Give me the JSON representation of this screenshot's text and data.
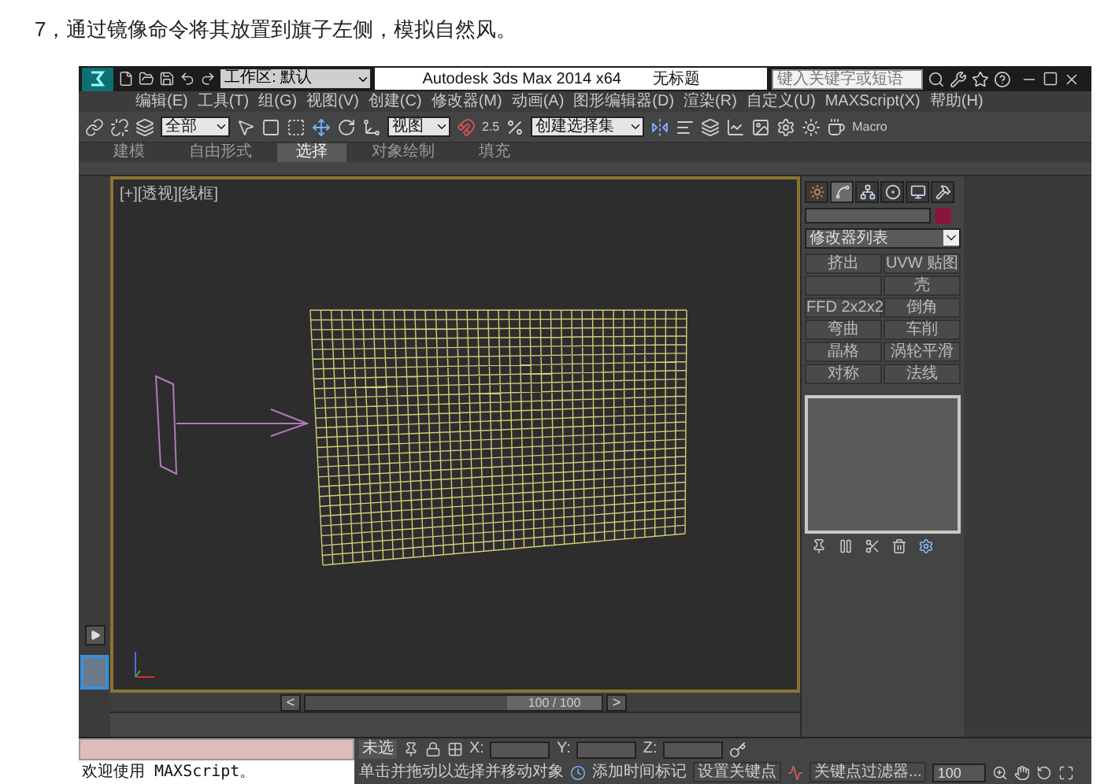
{
  "caption": "7，通过镜像命令将其放置到旗子左侧，模拟自然风。",
  "title_bar": {
    "workspace": "工作区: 默认",
    "title": "Autodesk 3ds Max 2014 x64",
    "document": "无标题",
    "search": {
      "placeholder": "键入关键字或短语"
    }
  },
  "menu": [
    "编辑(E)",
    "工具(T)",
    "组(G)",
    "视图(V)",
    "创建(C)",
    "修改器(M)",
    "动画(A)",
    "图形编辑器(D)",
    "渲染(R)",
    "自定义(U)",
    "MAXScript(X)",
    "帮助(H)"
  ],
  "toolbar": {
    "selection_filter": "全部",
    "reference_coord": "视图",
    "snap_value": "2.5",
    "selection_set": "创建选择集",
    "macro": "Macro"
  },
  "ribbon_tabs": [
    {
      "label": "建模",
      "selected": false
    },
    {
      "label": "自由形式",
      "selected": false
    },
    {
      "label": "选择",
      "selected": true
    },
    {
      "label": "对象绘制",
      "selected": false
    },
    {
      "label": "填充",
      "selected": false
    }
  ],
  "viewport": {
    "label": "[+][透视][线框]"
  },
  "command_panel": {
    "tabs": [
      {
        "selected": false
      },
      {
        "selected": true
      },
      {
        "selected": false
      },
      {
        "selected": false
      },
      {
        "selected": false
      },
      {
        "selected": false
      }
    ],
    "modifier_list": "修改器列表",
    "modifier_buttons": [
      {
        "kind": "command",
        "label": "挤出"
      },
      {
        "kind": "command",
        "label": "UVW 贴图"
      },
      {
        "kind": "blank"
      },
      {
        "kind": "command",
        "label": "壳"
      },
      {
        "kind": "command",
        "label": "FFD 2x2x2"
      },
      {
        "kind": "command",
        "label": "倒角"
      },
      {
        "kind": "command",
        "label": "弯曲"
      },
      {
        "kind": "command",
        "label": "车削"
      },
      {
        "kind": "command",
        "label": "晶格"
      },
      {
        "kind": "command",
        "label": "涡轮平滑"
      },
      {
        "kind": "command",
        "label": "对称"
      },
      {
        "kind": "command",
        "label": "法线"
      }
    ]
  },
  "time_slider": {
    "prev": "<",
    "position": "100 / 100",
    "level": 1,
    "next": ">"
  },
  "listener": {
    "output": "欢迎使用 MAXScript。"
  },
  "status": {
    "selection": "未选",
    "x_label": "X:",
    "y_label": "Y:",
    "z_label": "Z:",
    "prompt": "单击并拖动以选择并移动对象",
    "add_time_tag": "添加时间标记",
    "set_key": "设置关键点",
    "key_filters": "关键点过滤器...",
    "frame": "100"
  }
}
